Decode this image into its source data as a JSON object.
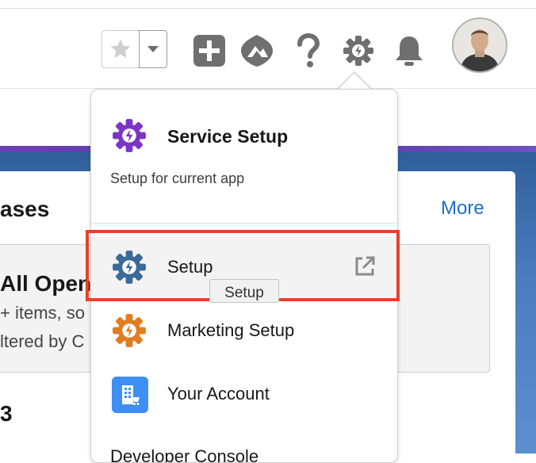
{
  "header": {
    "favorites": {
      "star_icon": "star-icon",
      "dropdown_icon": "chevron-down-icon"
    },
    "icons": [
      "add-icon",
      "trailhead-icon",
      "help-icon",
      "setup-gear-icon",
      "notifications-bell-icon"
    ],
    "avatar": "user-avatar"
  },
  "card": {
    "title": "ases",
    "more_link": "More",
    "list_name": "All Open",
    "list_meta_1": "+ items, so",
    "list_meta_2": "ltered by C",
    "count_prefix": "3"
  },
  "setup_menu": {
    "header_title": "Service Setup",
    "header_subtitle": "Setup for current app",
    "items": [
      {
        "label": "Setup",
        "icon": "setup-gear-icon",
        "external": true,
        "icon_color": "#3b6a99"
      },
      {
        "label": "Marketing Setup",
        "icon": "marketing-gear-icon",
        "external": false,
        "icon_color": "#e07d21"
      },
      {
        "label": "Your Account",
        "icon": "account-building-icon",
        "external": false,
        "icon_color": "#3d8ef5"
      }
    ],
    "cut_off_item": "Developer Console",
    "tooltip": "Setup"
  },
  "colors": {
    "service_gear": "#7b35c5",
    "highlight_border": "#e8412c",
    "link_blue": "#1b6fc9"
  }
}
